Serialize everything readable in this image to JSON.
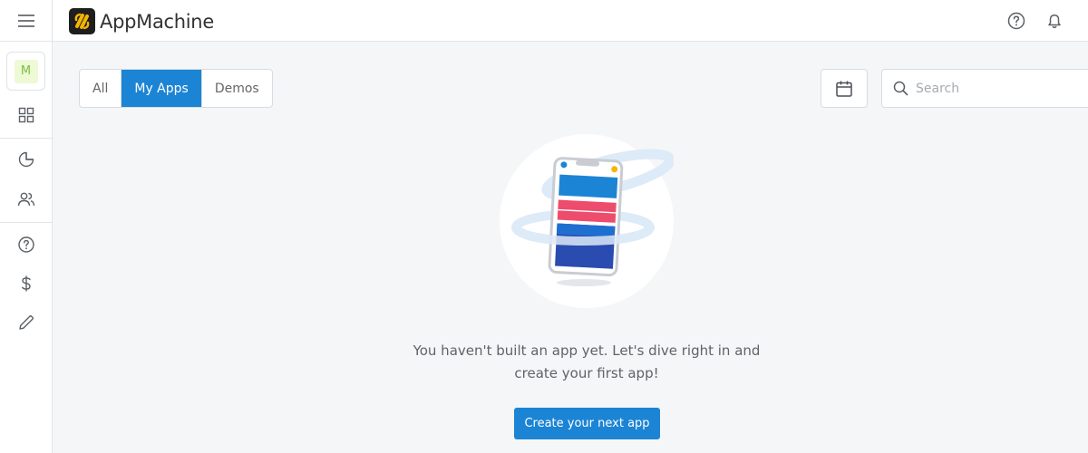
{
  "app": {
    "name": "AppMachine"
  },
  "sidebar": {
    "avatar_initial": "M"
  },
  "filters": {
    "tabs": [
      "All",
      "My Apps",
      "Demos"
    ],
    "active": "My Apps"
  },
  "search": {
    "placeholder": "Search"
  },
  "empty_state": {
    "line1": "You haven't built an app yet. Let's dive right in and",
    "line2": "create your first app!",
    "cta_label": "Create your next app"
  },
  "colors": {
    "primary": "#1c84d4",
    "logo_accent": "#f5b500",
    "avatar_green": "#7bc043"
  },
  "icons": [
    "menu-icon",
    "appmachine-logo-icon",
    "help-icon",
    "bell-icon",
    "grid-icon",
    "pie-chart-icon",
    "users-icon",
    "dollar-icon",
    "pencil-icon",
    "calendar-icon",
    "search-icon"
  ]
}
